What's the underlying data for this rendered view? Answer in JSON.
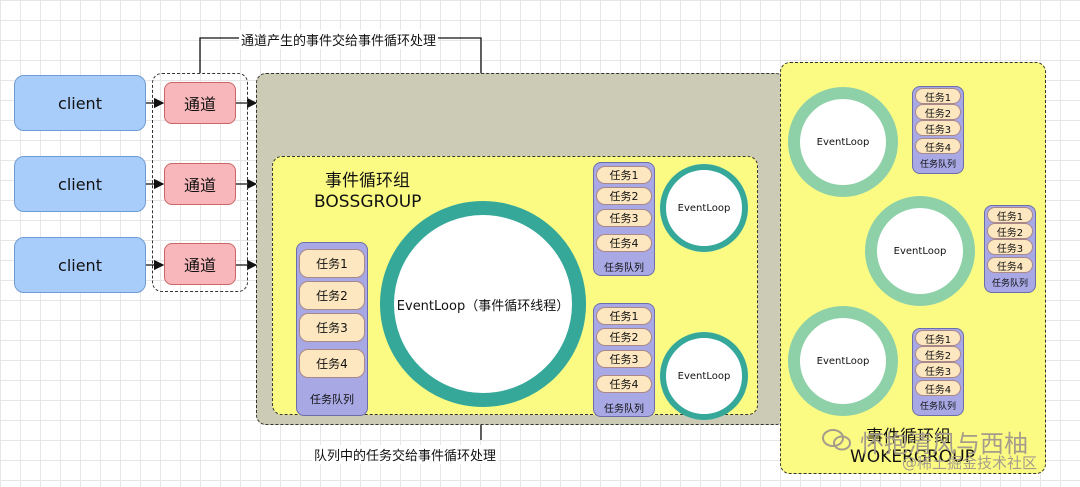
{
  "clients": [
    "client",
    "client",
    "client"
  ],
  "channels": [
    "通道",
    "通道",
    "通道"
  ],
  "top_caption": "通道产生的事件交给事件循环处理",
  "bottom_caption": "队列中的任务交给事件循环处理",
  "boss": {
    "title_line1": "事件循环组",
    "title_line2": "BOSSGROUP",
    "main_loop_label": "EventLoop（事件循环线程）",
    "main_queue": {
      "tasks": [
        "任务1",
        "任务2",
        "任务3",
        "任务4"
      ],
      "label": "任务队列"
    },
    "small_loops": [
      {
        "loop_label": "EventLoop",
        "tasks": [
          "任务1",
          "任务2",
          "任务3",
          "任务4"
        ],
        "queue_label": "任务队列"
      },
      {
        "loop_label": "EventLoop",
        "tasks": [
          "任务1",
          "任务2",
          "任务3",
          "任务4"
        ],
        "queue_label": "任务队列"
      }
    ]
  },
  "worker": {
    "title_line1": "事件循环组",
    "title_line2": "WOKERGROUP",
    "loops": [
      {
        "loop_label": "EventLoop",
        "tasks": [
          "任务1",
          "任务2",
          "任务3",
          "任务4"
        ],
        "queue_label": "任务队列"
      },
      {
        "loop_label": "EventLoop",
        "tasks": [
          "任务1",
          "任务2",
          "任务3",
          "任务4"
        ],
        "queue_label": "任务队列"
      },
      {
        "loop_label": "EventLoop",
        "tasks": [
          "任务1",
          "任务2",
          "任务3",
          "任务4"
        ],
        "queue_label": "任务队列"
      }
    ]
  },
  "watermark": {
    "line1": "怀抱清风与西柚",
    "line2": "@稀土掘金技术社区"
  },
  "colors": {
    "client_fill": "#a9cdfb",
    "channel_fill": "#f7b7bb",
    "group_fill": "#fbfb84",
    "outer_fill": "#cccbb5",
    "queue_fill": "#a7a8e4",
    "task_fill": "#fde7c0",
    "ring_teal": "#35a89a",
    "ring_light": "#8ed1a8"
  }
}
